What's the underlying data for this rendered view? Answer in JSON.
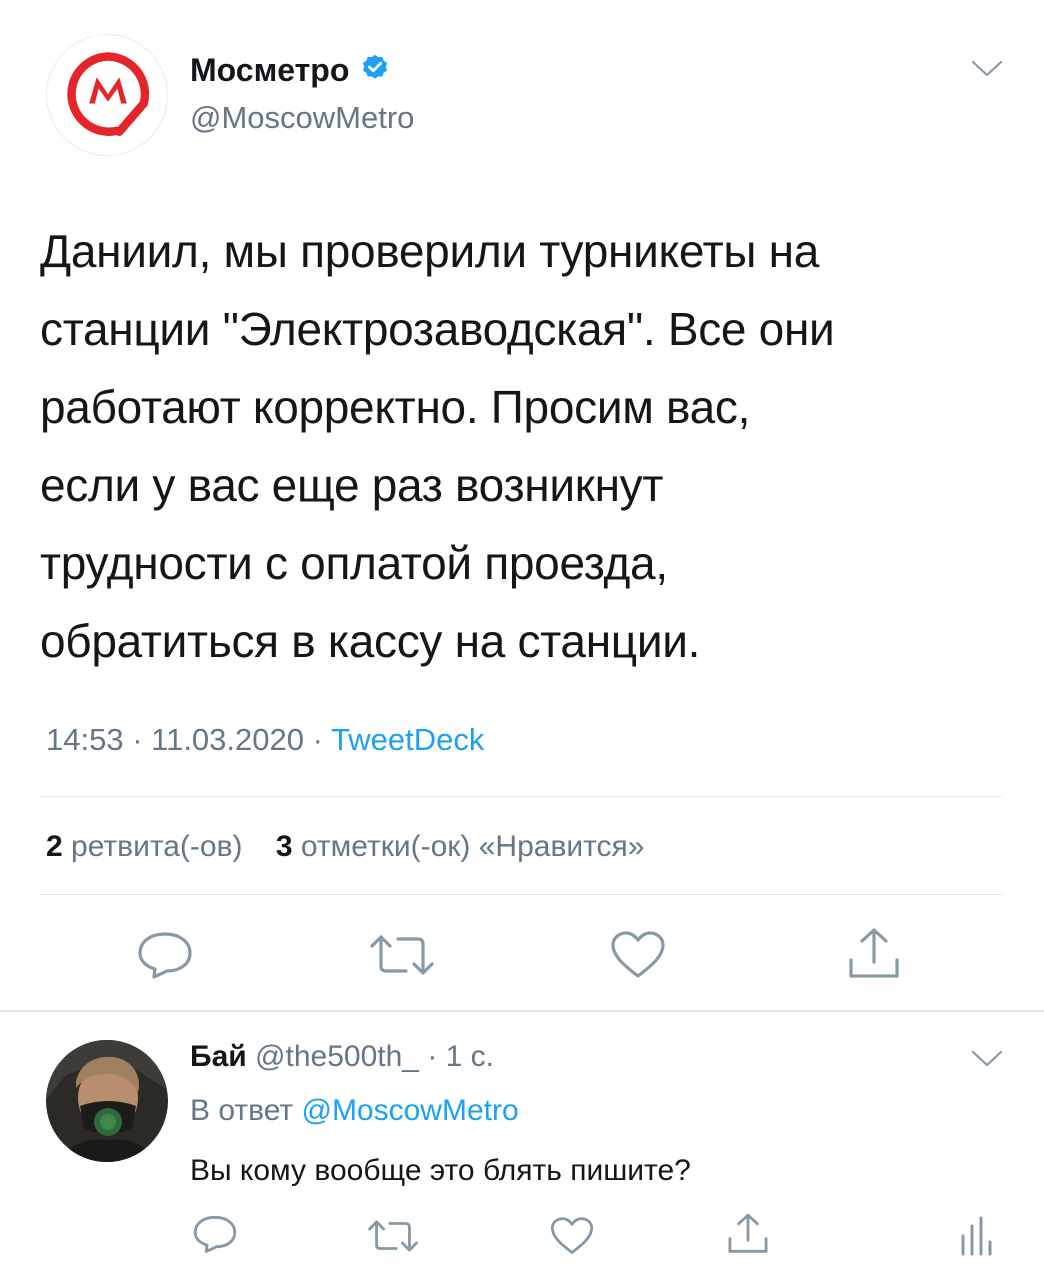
{
  "tweet": {
    "author_name": "Мосметро",
    "author_handle": "@MoscowMetro",
    "text_lines": [
      "Даниил, мы проверили турникеты на",
      "станции \"Электрозаводская\". Все они",
      "работают корректно. Просим вас,",
      "если у вас еще раз возникнут",
      "трудности с оплатой проезда,",
      "обратиться в кассу на станции."
    ],
    "time": "14:53",
    "date": "11.03.2020",
    "source": "TweetDeck",
    "separator": " · ",
    "retweets_count": "2",
    "retweets_label": "ретвита(-ов)",
    "likes_count": "3",
    "likes_label": "отметки(-ок) «Нравится»"
  },
  "reply": {
    "author_name": "Бай",
    "author_handle": "@the500th_",
    "age": "· 1 с.",
    "reply_to_prefix": "В ответ",
    "reply_to_handle": "@MoscowMetro",
    "text": "Вы кому вообще это блять пишите?"
  },
  "icons": {
    "logo": "moscow-metro-logo",
    "verified": "verified-badge-icon",
    "caret": "chevron-down-icon",
    "reply": "reply-icon",
    "retweet": "retweet-icon",
    "like": "heart-icon",
    "share": "share-icon",
    "analytics": "analytics-icon"
  },
  "colors": {
    "brand_red": "#e4262b",
    "link_blue": "#1da1f2",
    "muted_gray": "#657786",
    "text": "#14171a",
    "divider": "#e1e8ed"
  }
}
